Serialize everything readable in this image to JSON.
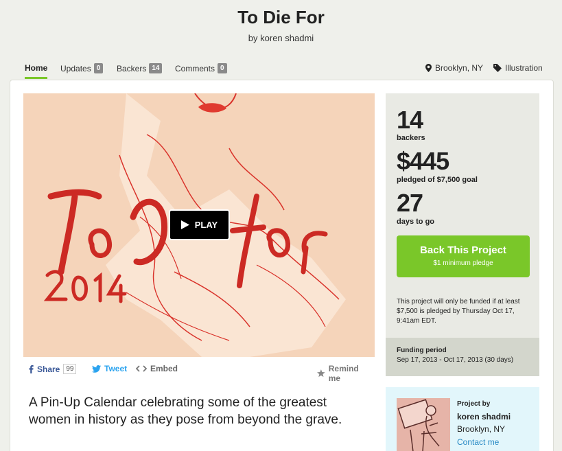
{
  "header": {
    "title": "To Die For",
    "byline": "by koren shadmi"
  },
  "nav": {
    "home": "Home",
    "updates": "Updates",
    "updates_count": "0",
    "backers": "Backers",
    "backers_count": "14",
    "comments": "Comments",
    "comments_count": "0",
    "location": "Brooklyn, NY",
    "category": "Illustration"
  },
  "video": {
    "play_label": "PLAY"
  },
  "share": {
    "share_label": "Share",
    "share_count": "99",
    "tweet_label": "Tweet",
    "embed_label": "Embed",
    "remind_label": "Remind me"
  },
  "blurb": "A Pin-Up Calendar celebrating some of the greatest women in history as they pose from beyond the grave.",
  "stats": {
    "backers_num": "14",
    "backers_label": "backers",
    "pledged_num": "$445",
    "pledged_label": "pledged of $7,500 goal",
    "days_num": "27",
    "days_label": "days to go"
  },
  "back_button": {
    "label": "Back This Project",
    "sub": "$1 minimum pledge"
  },
  "funded_note": "This project will only be funded if at least $7,500 is pledged by Thursday Oct 17, 9:41am EDT.",
  "funding_period": {
    "heading": "Funding period",
    "dates": "Sep 17, 2013 - Oct 17, 2013 (30 days)"
  },
  "creator": {
    "label": "Project by",
    "name": "koren shadmi",
    "location": "Brooklyn, NY",
    "contact": "Contact me"
  },
  "colors": {
    "accent_green": "#7ac729",
    "link_blue": "#2789c4",
    "background": "#eff0eb"
  }
}
